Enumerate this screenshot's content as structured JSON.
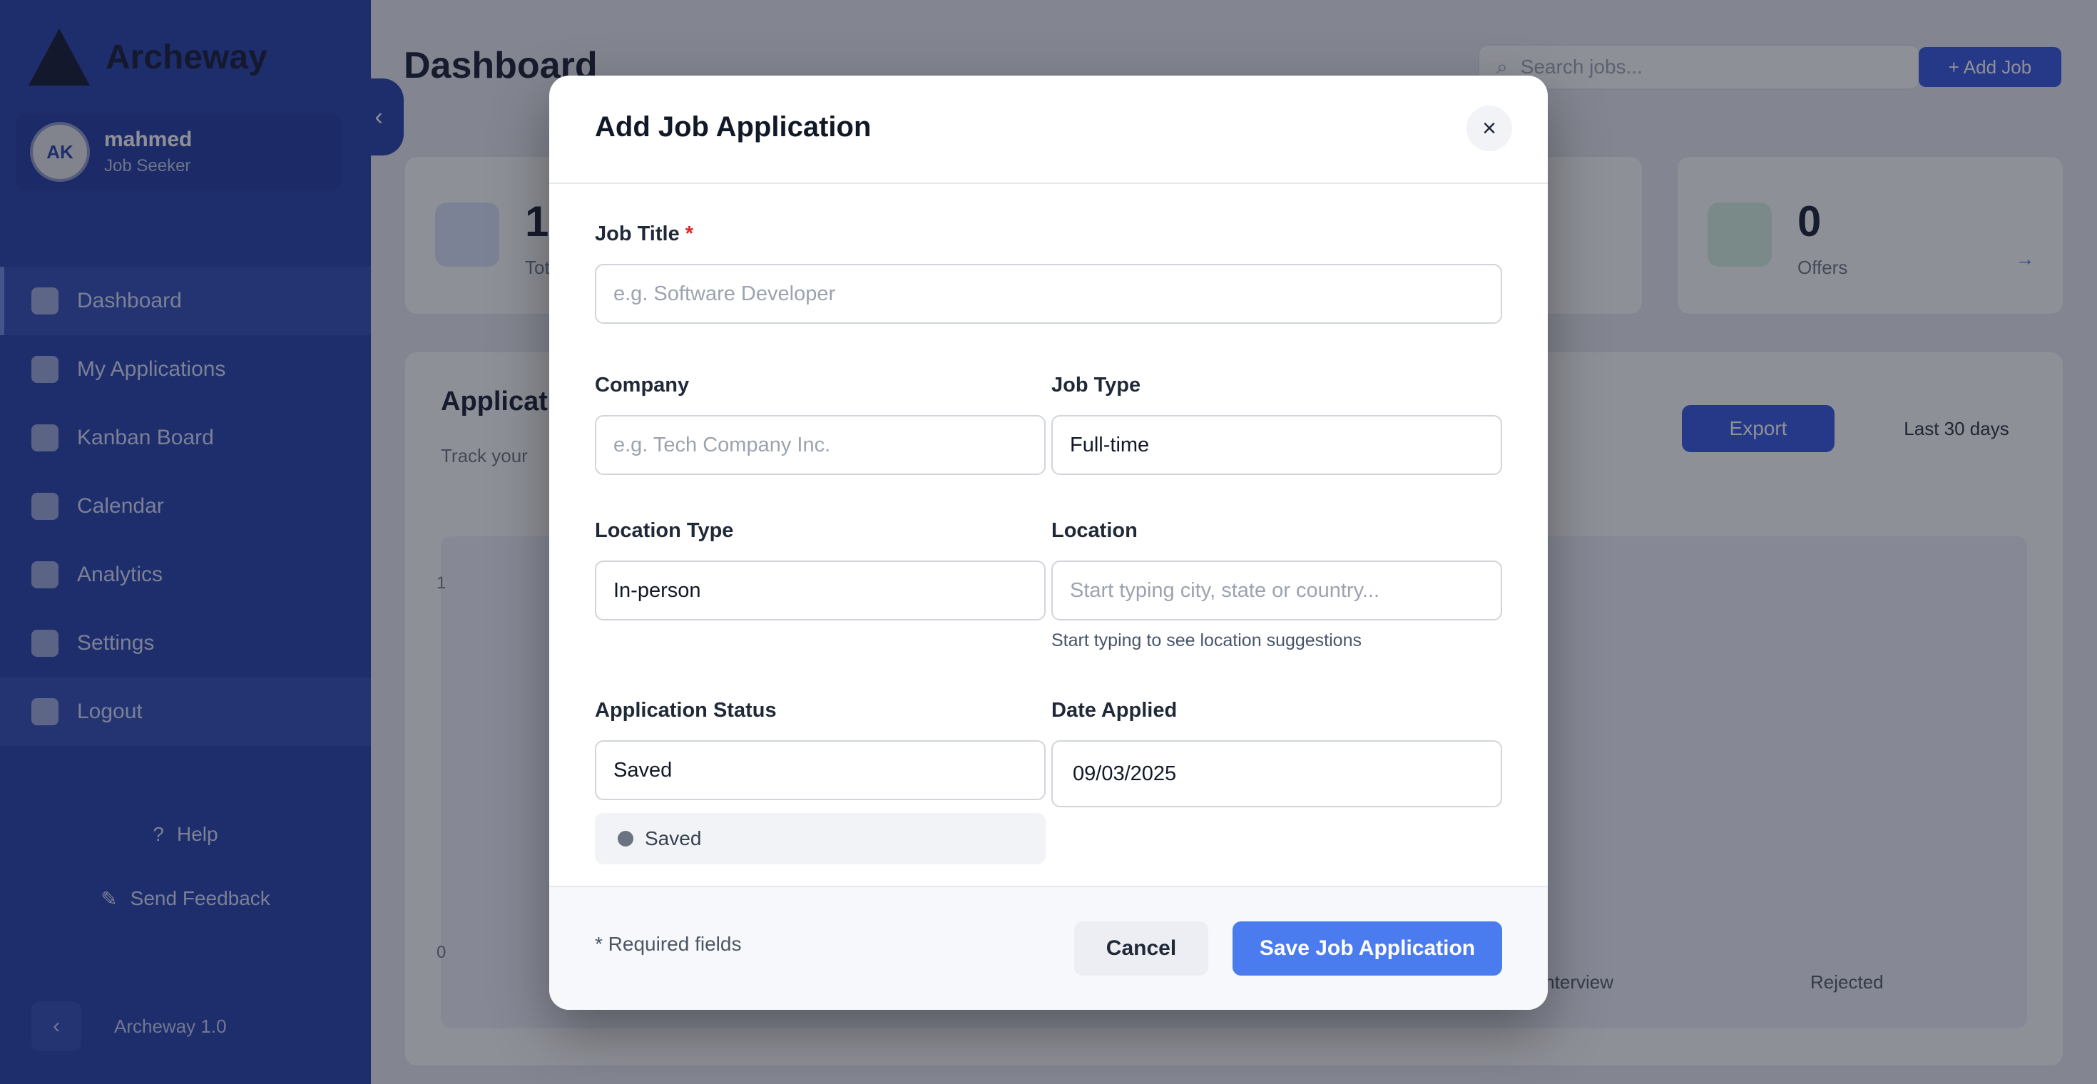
{
  "app": {
    "brand": "Archeway",
    "user": {
      "initials": "AK",
      "name": "mahmed",
      "role": "Job Seeker"
    },
    "nav": [
      "Dashboard",
      "My Applications",
      "Kanban Board",
      "Calendar",
      "Analytics",
      "Settings",
      "Logout"
    ],
    "help": "Help",
    "feedback": "Send Feedback",
    "version": "Archeway 1.0",
    "colors": {
      "sidebar": "#1e3aa8",
      "primary": "#2e4fe0",
      "save_button": "#4a7cf0",
      "required": "#dc2626"
    }
  },
  "main": {
    "title": "Dashboard",
    "search_placeholder": "Search jobs...",
    "add_job": "+ Add Job",
    "stats": [
      {
        "value": "1",
        "label": "Total"
      },
      {
        "value": "0",
        "label": "Offers",
        "link": "→"
      }
    ],
    "panel": {
      "title": "Applications",
      "subtitle": "Track your",
      "export": "Export",
      "range": "Last 30 days",
      "y_ticks": [
        "1",
        "0"
      ],
      "x_ticks": [
        "Interview",
        "Rejected"
      ]
    }
  },
  "modal": {
    "title": "Add Job Application",
    "close": "×",
    "job_title": {
      "label": "Job Title",
      "required_mark": "*",
      "placeholder": "e.g. Software Developer",
      "value": ""
    },
    "company": {
      "label": "Company",
      "placeholder": "e.g. Tech Company Inc.",
      "value": ""
    },
    "job_type": {
      "label": "Job Type",
      "value": "Full-time"
    },
    "location_type": {
      "label": "Location Type",
      "value": "In-person"
    },
    "location": {
      "label": "Location",
      "placeholder": "Start typing city, state or country...",
      "helper": "Start typing to see location suggestions"
    },
    "status": {
      "label": "Application Status",
      "value": "Saved",
      "chip": "Saved"
    },
    "date_applied": {
      "label": "Date Applied",
      "value": "09/03/2025"
    },
    "footer": {
      "required_note": "* Required fields",
      "cancel": "Cancel",
      "save": "Save Job Application"
    }
  }
}
